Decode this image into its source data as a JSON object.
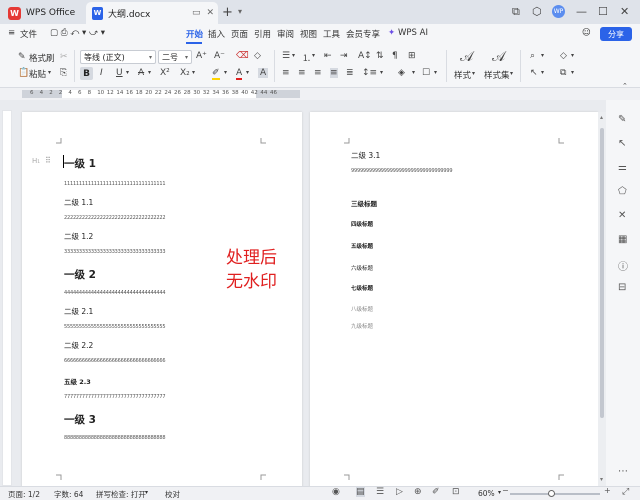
{
  "titlebar": {
    "app_tab": "WPS Office",
    "doc_tab": "大纲.docx",
    "avatar_text": "WP"
  },
  "menubar": {
    "file": "文件",
    "items": [
      "开始",
      "插入",
      "页面",
      "引用",
      "审阅",
      "视图",
      "工具",
      "会员专享"
    ],
    "wps_ai": "WPS AI",
    "share": "分享"
  },
  "ribbon": {
    "format_painter": "格式刷",
    "paste": "粘贴",
    "font_name": "等线 (正文)",
    "font_size": "二号",
    "styles": "样式",
    "style_set": "样式集"
  },
  "ruler": {
    "numbers": [
      "6",
      "4",
      "2",
      "2",
      "4",
      "6",
      "8",
      "10",
      "12",
      "14",
      "16",
      "18",
      "20",
      "22",
      "24",
      "26",
      "28",
      "30",
      "32",
      "34",
      "36",
      "38",
      "40",
      "42",
      "44",
      "46"
    ]
  },
  "page1": {
    "heading_marker": "H₁",
    "h1_a": "一级 1",
    "num_a": "1111111111111111111111111111111111",
    "h2_11": "二级 1.1",
    "num_11": "2222222222222222222222222222222222",
    "h2_12": "二级 1.2",
    "num_12": "3333333333333333333333333333333333",
    "h1_b": "一级 2",
    "num_b": "4444444444444444444444444444444444",
    "h2_21": "二级 2.1",
    "num_21": "5555555555555555555555555555555555",
    "h2_22": "二级 2.2",
    "num_22": "6666666666666666666666666666666666",
    "h5_23": "五级 2.3",
    "num_23": "7777777777777777777777777777777777",
    "h1_c": "一级 3",
    "num_c": "8888888888888888888888888888888888"
  },
  "watermark": {
    "line1": "处理后",
    "line2": "无水印"
  },
  "page2": {
    "h2_31": "二级 3.1",
    "num_31": "9999999999999999999999999999999999",
    "h3": "三级标题",
    "h4": "四级标题",
    "h5": "五级标题",
    "h6": "六级标题",
    "h7": "七级标题",
    "h8": "八级标题",
    "h9": "九级标题"
  },
  "statusbar": {
    "page": "页面: 1/2",
    "words": "字数: 64",
    "spell": "拼写检查: 打开",
    "proof": "校对",
    "zoom": "60%"
  }
}
